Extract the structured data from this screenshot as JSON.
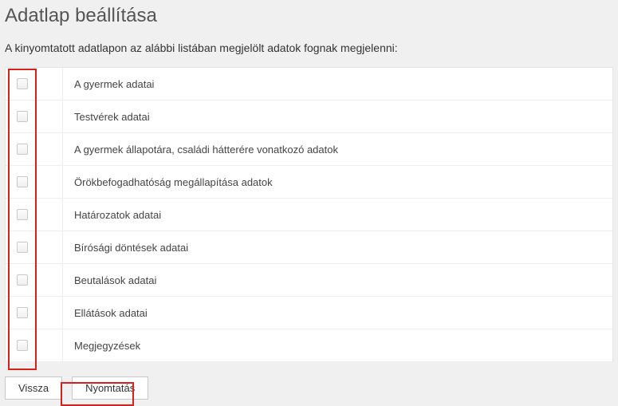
{
  "title": "Adatlap beállítása",
  "subtext": "A kinyomtatott adatlapon az alábbi listában megjelölt adatok fognak megjelenni:",
  "rows": [
    {
      "label": "A gyermek adatai",
      "checked": false
    },
    {
      "label": "Testvérek adatai",
      "checked": false
    },
    {
      "label": "A gyermek állapotára, családi hátterére vonatkozó adatok",
      "checked": false
    },
    {
      "label": "Örökbefogadhatóság megállapítása adatok",
      "checked": false
    },
    {
      "label": "Határozatok adatai",
      "checked": false
    },
    {
      "label": "Bírósági döntések adatai",
      "checked": false
    },
    {
      "label": "Beutalások adatai",
      "checked": false
    },
    {
      "label": "Ellátások adatai",
      "checked": false
    },
    {
      "label": "Megjegyzések",
      "checked": false
    }
  ],
  "buttons": {
    "back": "Vissza",
    "print": "Nyomtatás"
  }
}
